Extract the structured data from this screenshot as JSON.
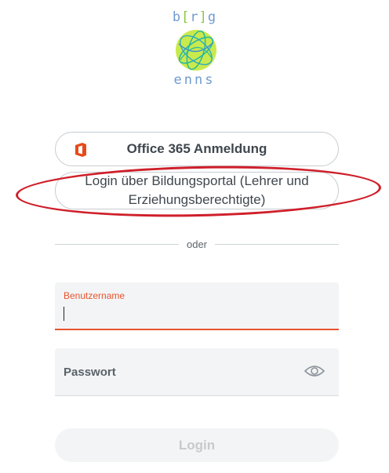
{
  "logo": {
    "top_text": "b[r]g",
    "bottom_text": "enns"
  },
  "office_button": {
    "label": "Office 365 Anmeldung",
    "icon": "office-365-icon"
  },
  "portal_button": {
    "label": "Login über Bildungsportal (Lehrer und Erziehungsberechtigte)"
  },
  "divider": {
    "label": "oder"
  },
  "username": {
    "label": "Benutzername",
    "value": "",
    "accent": "#e8542f"
  },
  "password": {
    "label": "Passwort",
    "icon": "eye-icon"
  },
  "login_button": {
    "label": "Login",
    "state": "disabled"
  },
  "annotation": {
    "color": "#cf1f2a"
  }
}
